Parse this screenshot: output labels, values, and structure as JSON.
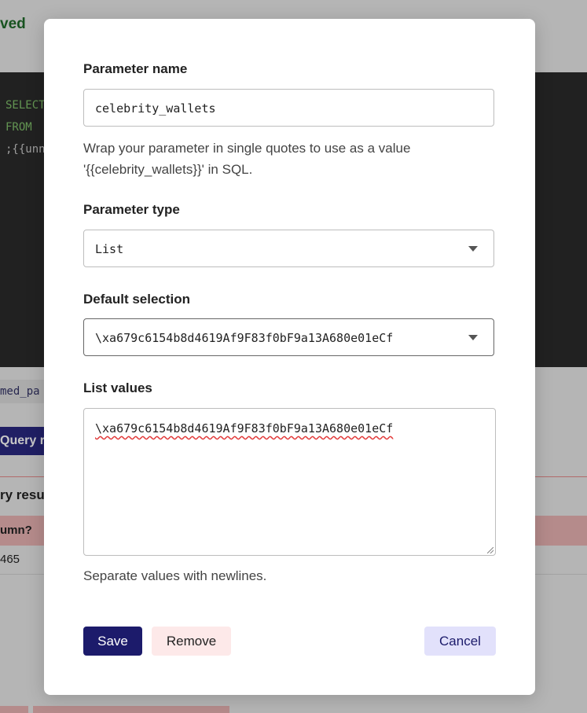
{
  "background": {
    "status_text": "ved",
    "code_lines": [
      "SELECT",
      "FROM ",
      ";{{unn"
    ],
    "param_chip": "med_pa",
    "run_button": "Query re",
    "results_title": "ry result",
    "column_header": "umn?",
    "row_value": "465"
  },
  "modal": {
    "param_name": {
      "label": "Parameter name",
      "value": "celebrity_wallets",
      "help": "Wrap your parameter in single quotes to use as a value '{{celebrity_wallets}}' in SQL."
    },
    "param_type": {
      "label": "Parameter type",
      "value": "List"
    },
    "default_selection": {
      "label": "Default selection",
      "value": "\\xa679c6154b8d4619Af9F83f0bF9a13A680e01eCf"
    },
    "list_values": {
      "label": "List values",
      "value": "\\xa679c6154b8d4619Af9F83f0bF9a13A680e01eCf",
      "help": "Separate values with newlines."
    },
    "buttons": {
      "save": "Save",
      "remove": "Remove",
      "cancel": "Cancel"
    }
  }
}
